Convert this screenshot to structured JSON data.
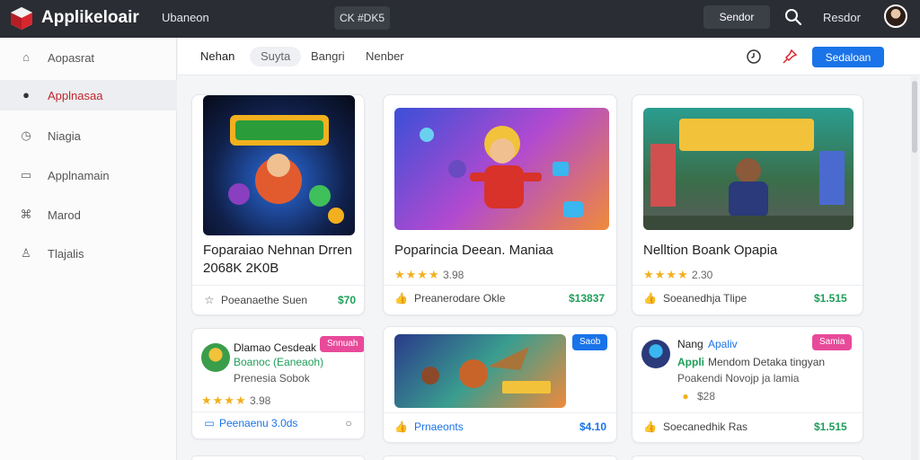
{
  "topbar": {
    "app_name": "Applikeloair",
    "link": "Ubaneon",
    "center": "CK #DK5",
    "button_label": "Sendor",
    "user": "Resdor"
  },
  "sidebar": {
    "items": [
      {
        "label": "Aopasrat",
        "icon": "home-icon"
      },
      {
        "label": "Applnasaa",
        "icon": "user-icon",
        "active": true
      },
      {
        "label": "Niagia",
        "icon": "clock-icon"
      },
      {
        "label": "Applnamain",
        "icon": "calendar-icon"
      },
      {
        "label": "Marod",
        "icon": "tag-icon"
      },
      {
        "label": "Tlajalis",
        "icon": "shop-icon"
      }
    ]
  },
  "subheader": {
    "tabs": [
      "Nehan",
      "Suyta",
      "Bangri",
      "Nenber"
    ],
    "primary_button": "Sedaloan"
  },
  "cards": [
    {
      "title": "Foparaiao Nehnan Drren",
      "subtitle": "2068K 2K0B",
      "footer": "Poeanaethe Suen",
      "price": "$70"
    },
    {
      "title": "Poparincia Deean. Maniaa",
      "rating": "3.98",
      "footer": "Preanerodare Okle",
      "price": "$13837"
    },
    {
      "title": "Nelltion Boank Opapia",
      "rating": "2.30",
      "footer": "Soeanedhja Tlipe",
      "price": "$1.515"
    },
    {
      "title": "Dlamao Cesdeak",
      "line2": "Boanoc (Eaneaoh)",
      "line3": "Prenesia Sobok",
      "badge": "Snnuah",
      "rating": "3.98",
      "footer": "Peenaenu 3.0ds"
    },
    {
      "badge": "Saob",
      "footer": "Prnaeonts",
      "price": "$4.10"
    },
    {
      "title_a": "Nang",
      "title_b": "Apaliv",
      "line2_a": "Appli",
      "line2_b": "Mendom Detaka tingyan",
      "line3": "Poakendi Novojp ja lamia",
      "rating": "$28",
      "badge": "Samia",
      "footer": "Soecanedhik Ras",
      "price": "$1.515"
    }
  ],
  "colors": {
    "accent": "#1a73e8",
    "active": "#c0262d",
    "price": "#1e9e5a",
    "star": "#f2b01e"
  }
}
